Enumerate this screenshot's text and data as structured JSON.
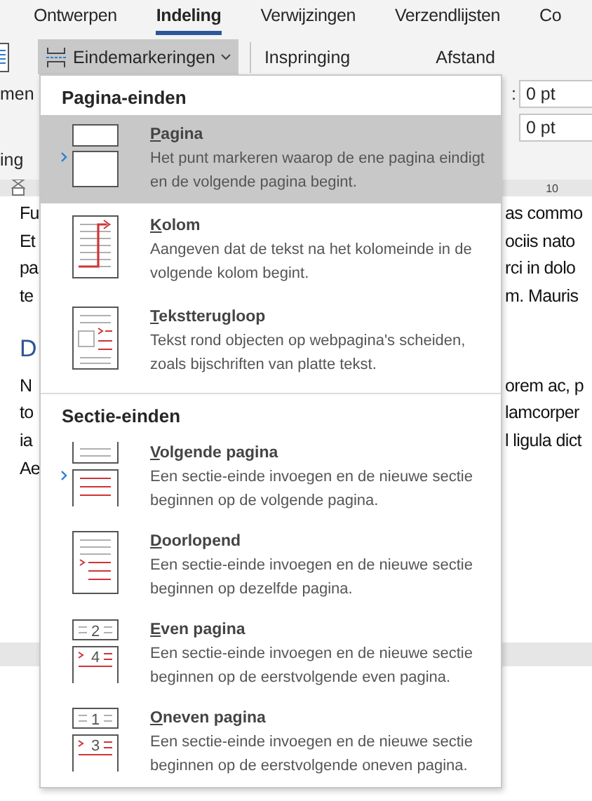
{
  "tabs": [
    {
      "label": "Ontwerpen",
      "selected": false
    },
    {
      "label": "Indeling",
      "selected": true
    },
    {
      "label": "Verwijzingen",
      "selected": false
    },
    {
      "label": "Verzendlijsten",
      "selected": false
    },
    {
      "label": "Co",
      "selected": false
    }
  ],
  "ribbon": {
    "breaks_button": {
      "label": "Eindemarkeringen",
      "open": true
    },
    "indent_label": "Inspringing",
    "spacing_label": "Afstand",
    "left_labels": [
      "men",
      "ing"
    ],
    "spacing_field_label": ":",
    "spacing_fields": [
      {
        "value": "0 pt"
      },
      {
        "value": "0 pt"
      }
    ]
  },
  "ruler": {
    "mark": "10"
  },
  "document": {
    "lines": [
      {
        "kind": "body",
        "left": "Fu",
        "right": "as commo"
      },
      {
        "kind": "body",
        "left": "Et",
        "right": "ociis nato"
      },
      {
        "kind": "body",
        "left": "pa",
        "right": "rci in dolo"
      },
      {
        "kind": "body",
        "left": "te",
        "right": "m. Mauris"
      },
      {
        "kind": "heading",
        "left": "D"
      },
      {
        "kind": "body",
        "left": "N",
        "right": "orem ac, p"
      },
      {
        "kind": "body",
        "left": "to",
        "right": "lamcorper"
      },
      {
        "kind": "body",
        "left": "ia",
        "right": "l ligula dict"
      },
      {
        "kind": "body",
        "left": "Ae"
      }
    ]
  },
  "menu": {
    "sections": [
      {
        "heading": "Pagina-einden",
        "items": [
          {
            "kind": "page",
            "title": "Pagina",
            "description": "Het punt markeren waarop de ene pagina eindigt en de volgende pagina begint.",
            "selected": true,
            "arrow": true
          },
          {
            "kind": "column",
            "title": "Kolom",
            "description": "Aangeven dat de tekst na het kolomeinde in de volgende kolom begint.",
            "selected": false,
            "arrow": false
          },
          {
            "kind": "wrap",
            "title": "Tekstterugloop",
            "description": "Tekst rond objecten op webpagina's scheiden, zoals bijschriften van platte tekst.",
            "selected": false,
            "arrow": false
          }
        ]
      },
      {
        "heading": "Sectie-einden",
        "items": [
          {
            "kind": "next",
            "title": "Volgende pagina",
            "description": "Een sectie-einde invoegen en de nieuwe sectie beginnen op de volgende pagina.",
            "selected": false,
            "arrow": true
          },
          {
            "kind": "continuous",
            "title": "Doorlopend",
            "description": "Een sectie-einde invoegen en de nieuwe sectie beginnen op dezelfde pagina.",
            "selected": false,
            "arrow": false
          },
          {
            "kind": "numbered",
            "title": "Even pagina",
            "description": "Een sectie-einde invoegen en de nieuwe sectie beginnen op de eerstvolgende even pagina.",
            "selected": false,
            "arrow": false,
            "icon_labels": [
              "2",
              "4"
            ]
          },
          {
            "kind": "numbered",
            "title": "Oneven pagina",
            "description": "Een sectie-einde invoegen en de nieuwe sectie beginnen op de eerstvolgende oneven pagina.",
            "selected": false,
            "arrow": false,
            "icon_labels": [
              "1",
              "3"
            ]
          }
        ]
      }
    ]
  }
}
